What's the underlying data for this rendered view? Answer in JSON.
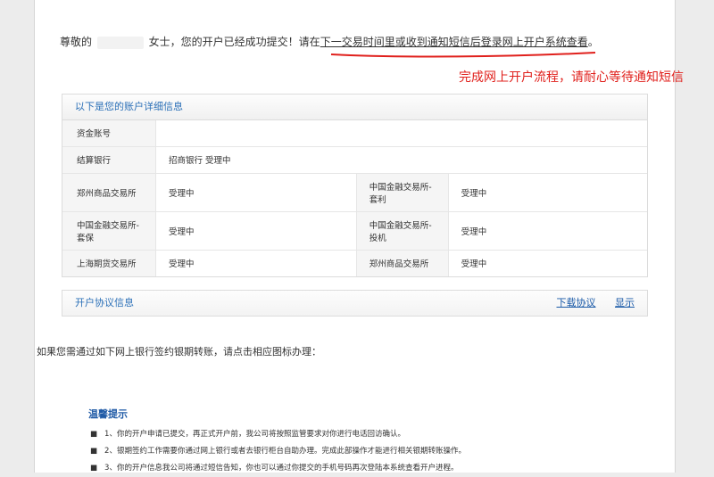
{
  "greeting": {
    "prefix": "尊敬的",
    "suffix": "女士，您的开户已经成功提交！请在",
    "underlined": "下一交易时间里或收到通知短信后登录网上开户系统查看",
    "end": "。"
  },
  "annotation": "完成网上开户流程，请耐心等待通知短信",
  "account_panel": {
    "title": "以下是您的账户详细信息",
    "rows": {
      "fund_account": {
        "label": "资金账号",
        "value": ""
      },
      "settlement_bank": {
        "label": "结算银行",
        "value": "招商银行 受理中"
      },
      "row3": {
        "l1": "郑州商品交易所",
        "v1": "受理中",
        "l2": "中国金融交易所-套利",
        "v2": "受理中"
      },
      "row4": {
        "l1": "中国金融交易所-套保",
        "v1": "受理中",
        "l2": "中国金融交易所-投机",
        "v2": "受理中"
      },
      "row5": {
        "l1": "上海期货交易所",
        "v1": "受理中",
        "l2": "郑州商品交易所",
        "v2": "受理中"
      }
    }
  },
  "agreement_panel": {
    "title": "开户协议信息",
    "download": "下载协议",
    "show": "显示"
  },
  "bank_line": "如果您需通过如下网上银行签约银期转账，请点击相应图标办理：",
  "tips": {
    "title": "温馨提示",
    "items": [
      {
        "bullet": "■",
        "text": "1、你的开户申请已提交，再正式开户前，我公司将按照监管要求对你进行电话回访确认。"
      },
      {
        "bullet": "■",
        "text": "2、银期签约工作需要你通过网上银行或者去银行柜台自助办理。完成此部操作才能进行相关银期转账操作。"
      },
      {
        "bullet": "■",
        "text": "3、你的开户信息我公司将通过短信告知，你也可以通过你提交的手机号码再次登陆本系统查看开户进程。"
      }
    ]
  },
  "colors": {
    "accent": "#2a6fb7",
    "annotation": "#e0201c",
    "underline": "#e0201c"
  }
}
